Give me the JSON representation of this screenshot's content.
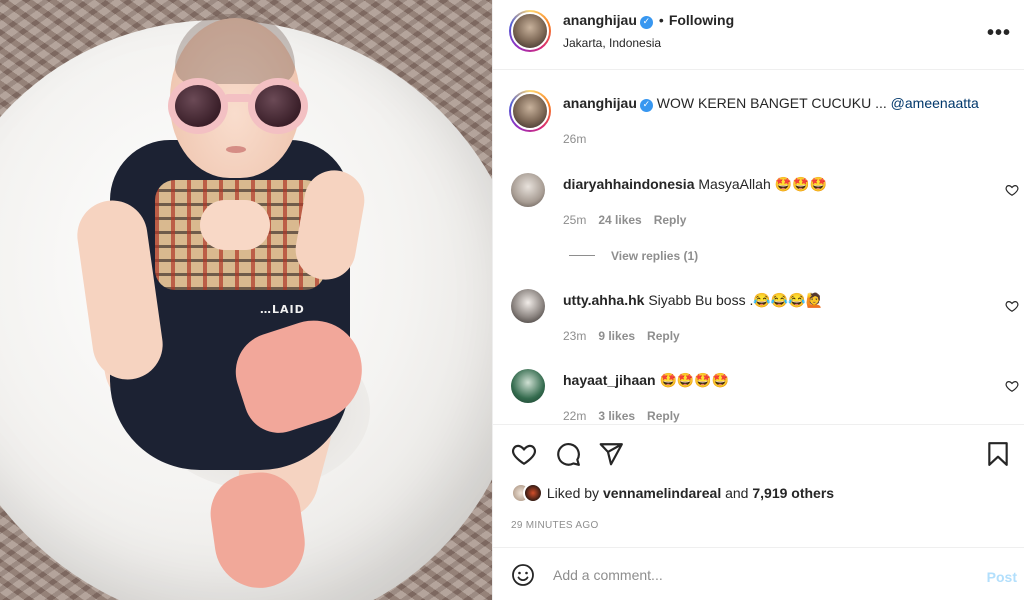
{
  "header": {
    "username": "ananghijau",
    "verified_mark": "✓",
    "dot": "•",
    "follow_status": "Following",
    "location": "Jakarta, Indonesia",
    "more_icon": "more-horizontal-icon",
    "more_glyph": "•••"
  },
  "photo": {
    "shirt_print_text": "…LAID"
  },
  "caption": {
    "username": "ananghijau",
    "text": "WOW KEREN BANGET CUCUKU ...",
    "mention": "@ameenaatta",
    "time": "26m"
  },
  "comments": [
    {
      "username": "diaryahhaindonesia",
      "text": "MasyaAllah 🤩🤩🤩",
      "time": "25m",
      "likes": "24 likes",
      "reply": "Reply"
    },
    {
      "username": "utty.ahha.hk",
      "text": "Siyabb Bu boss .😂😂😂🙋",
      "time": "23m",
      "likes": "9 likes",
      "reply": "Reply"
    },
    {
      "username": "hayaat_jihaan",
      "text": "🤩🤩🤩🤩",
      "time": "22m",
      "likes": "3 likes",
      "reply": "Reply"
    }
  ],
  "view_replies": "View replies (1)",
  "actions": {
    "like_icon": "heart-icon",
    "comment_icon": "comment-icon",
    "share_icon": "send-icon",
    "save_icon": "bookmark-icon"
  },
  "likes": {
    "prefix": "Liked by",
    "user": "vennamelindareal",
    "and": "and",
    "others": "7,919 others"
  },
  "timestamp": "29 MINUTES AGO",
  "add_comment": {
    "placeholder": "Add a comment...",
    "post_label": "Post",
    "emoji_icon": "smiley-icon"
  },
  "colors": {
    "link": "#00376b",
    "muted": "#8e8e8e",
    "verified": "#3897f0",
    "post_disabled": "#b2dffc"
  }
}
